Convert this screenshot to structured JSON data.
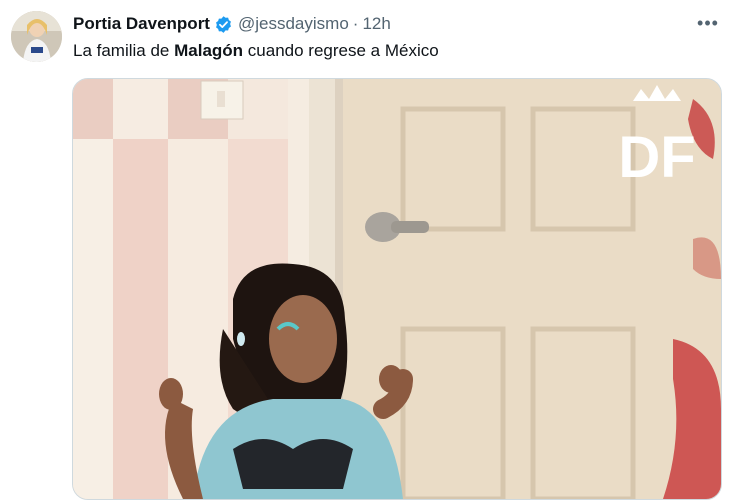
{
  "tweet": {
    "author_name": "Portia Davenport",
    "handle": "@jessdayismo",
    "separator": "·",
    "time": "12h",
    "text_before": "La familia de ",
    "text_bold": "Malagón",
    "text_after": " cuando regrese a México",
    "more_label": "•••"
  },
  "media": {
    "watermark_text": "DF"
  },
  "colors": {
    "verified": "#1d9bf0",
    "secondary_text": "#536471",
    "primary_text": "#0f1419"
  }
}
